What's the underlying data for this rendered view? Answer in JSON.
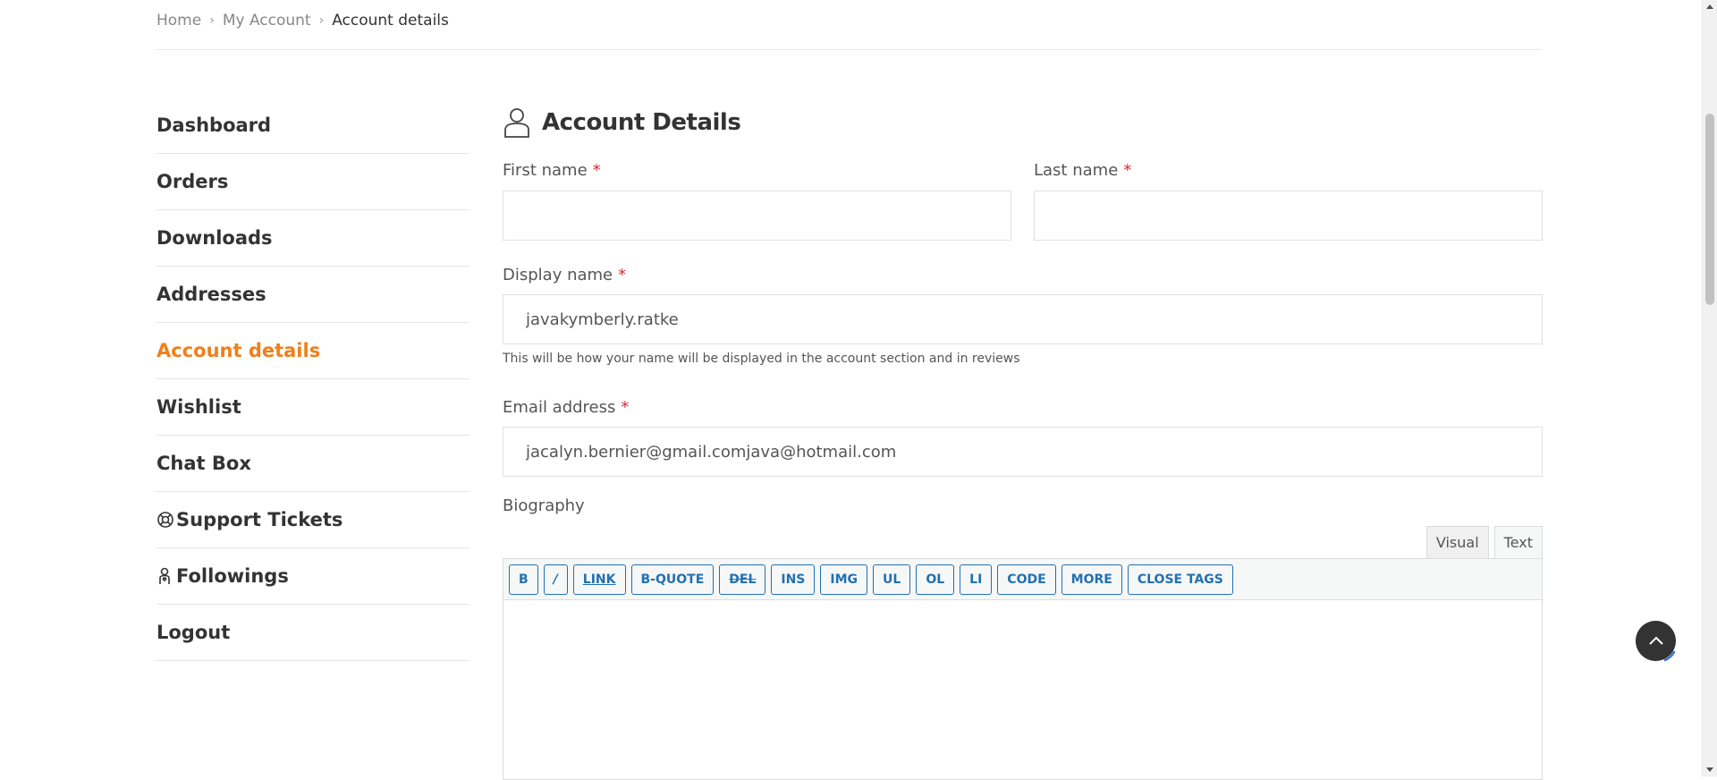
{
  "breadcrumb": {
    "items": [
      "Home",
      "My Account"
    ],
    "current": "Account details"
  },
  "sidebar": {
    "items": [
      {
        "label": "Dashboard"
      },
      {
        "label": "Orders"
      },
      {
        "label": "Downloads"
      },
      {
        "label": "Addresses"
      },
      {
        "label": "Account details",
        "active": true
      },
      {
        "label": "Wishlist"
      },
      {
        "label": "Chat Box"
      },
      {
        "label": "Support Tickets",
        "icon": "lifebuoy-icon"
      },
      {
        "label": "Followings",
        "icon": "user-heart-icon"
      },
      {
        "label": "Logout"
      }
    ]
  },
  "main": {
    "title": "Account Details",
    "title_icon": "user-icon",
    "first_name": {
      "label": "First name",
      "required": "*",
      "value": ""
    },
    "last_name": {
      "label": "Last name",
      "required": "*",
      "value": ""
    },
    "display_name": {
      "label": "Display name",
      "required": "*",
      "value": "javakymberly.ratke",
      "hint": "This will be how your name will be displayed in the account section and in reviews"
    },
    "email": {
      "label": "Email address",
      "required": "*",
      "value": "jacalyn.bernier@gmail.comjava@hotmail.com"
    },
    "biography": {
      "label": "Biography",
      "tabs": [
        "Visual",
        "Text"
      ],
      "active_tab": "Text",
      "toolbar": [
        "B",
        "/",
        "LINK",
        "B-QUOTE",
        "DEL",
        "INS",
        "IMG",
        "UL",
        "OL",
        "LI",
        "CODE",
        "MORE",
        "CLOSE TAGS"
      ]
    }
  },
  "colors": {
    "accent": "#f07f1b",
    "required": "#e0263b",
    "toolbar_button": "#2271b1",
    "back_to_top_bg": "#333333",
    "back_to_top_ring": "#3b6fd4"
  },
  "icons": {
    "back_to_top": "chevron-up-icon"
  }
}
